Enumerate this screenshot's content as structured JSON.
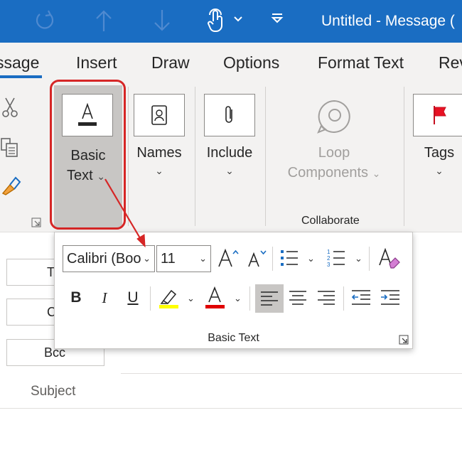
{
  "titlebar": {
    "title": "Untitled  -  Message (",
    "bg": "#1a6dc2",
    "icons": [
      "undo-icon",
      "up-arrow-icon",
      "down-arrow-icon",
      "touch-mode-icon",
      "chevron-down-icon",
      "customize-qat-icon"
    ]
  },
  "tabs": [
    {
      "label": "ssage",
      "active": true
    },
    {
      "label": "Insert"
    },
    {
      "label": "Draw"
    },
    {
      "label": "Options"
    },
    {
      "label": "Format Text"
    },
    {
      "label": "Rev"
    }
  ],
  "ribbon": {
    "clipboard_icons": [
      "cut-icon",
      "copy-icon",
      "format-painter-icon"
    ],
    "basic_text": {
      "line1": "Basic",
      "line2": "Text"
    },
    "names": {
      "label": "Names"
    },
    "include": {
      "label": "Include"
    },
    "loop": {
      "line1": "Loop",
      "line2": "Components"
    },
    "tags": {
      "label": "Tags"
    },
    "collaborate_group": "Collaborate"
  },
  "compose": {
    "to_label": "T",
    "cc_label": "C",
    "bcc_label": "Bcc",
    "subject_label": "Subject"
  },
  "popup": {
    "font_name": "Calibri (Boo",
    "font_size": "11",
    "bold": "B",
    "italic": "I",
    "underline": "U",
    "group_label": "Basic Text",
    "highlight_color": "#ffff00",
    "font_color": "#e00000"
  },
  "annotation": {
    "color": "#d62626"
  }
}
